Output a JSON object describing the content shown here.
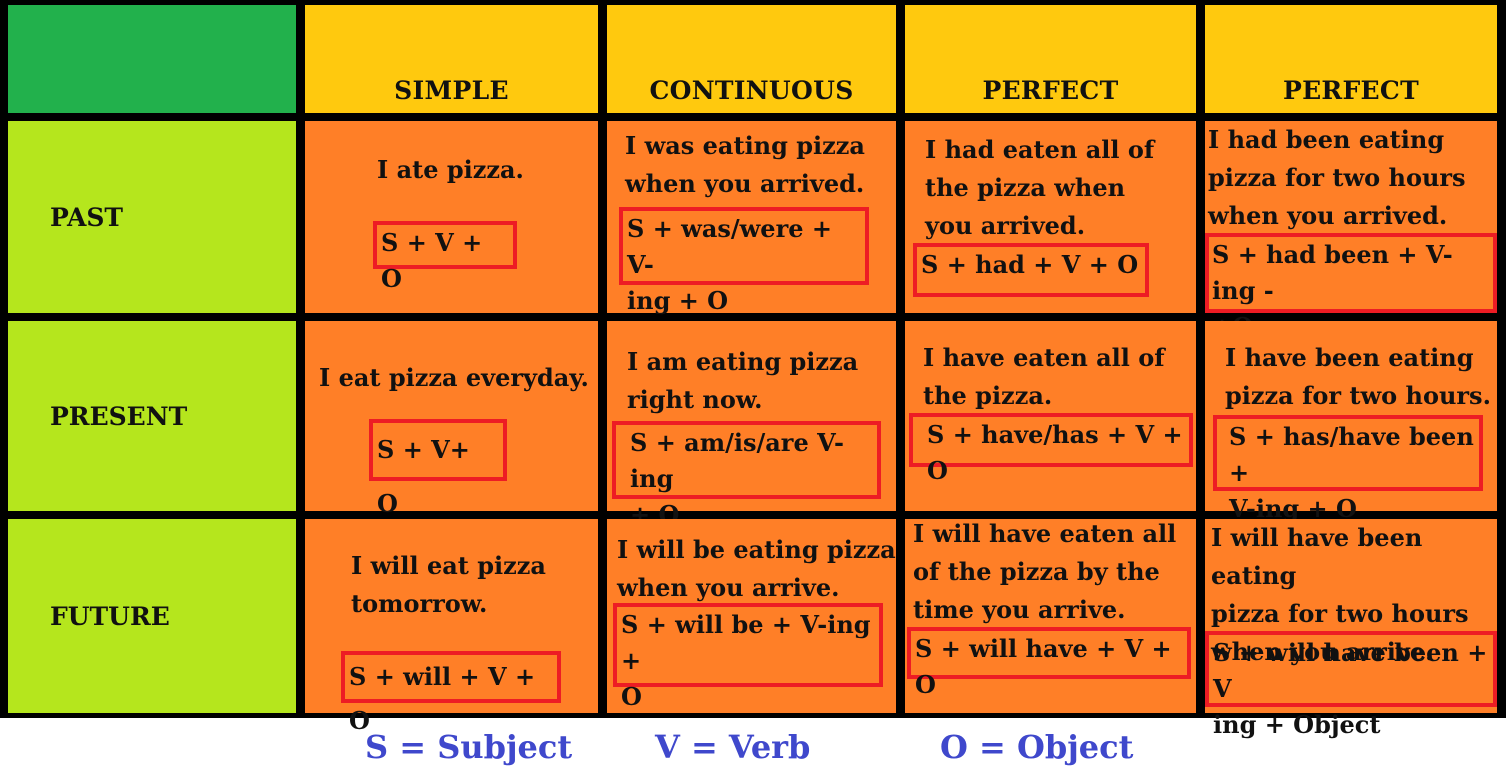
{
  "table": {
    "columns": [
      "SIMPLE",
      "CONTINUOUS",
      "PERFECT",
      "PERFECT"
    ],
    "rows": [
      {
        "label": "PAST",
        "cells": [
          {
            "example": "I ate pizza.",
            "formula": "S + V + O"
          },
          {
            "example": "I was eating pizza\nwhen you arrived.",
            "formula": "S + was/were + V-\ning + O"
          },
          {
            "example": "I had eaten all of\nthe pizza when\nyou arrived.",
            "formula": "S + had + V + O"
          },
          {
            "example": "I had been eating\npizza for two hours\nwhen you arrived.",
            "formula": "S + had been + V-ing -\n+O"
          }
        ]
      },
      {
        "label": "PRESENT",
        "cells": [
          {
            "example": "I eat pizza everyday.",
            "formula": "S + V+ O"
          },
          {
            "example": "I am eating pizza\nright now.",
            "formula": "S + am/is/are V-ing\n+ O"
          },
          {
            "example": "I have eaten all of\nthe pizza.",
            "formula": "S + have/has + V + O"
          },
          {
            "example": "I have been eating\npizza for two hours.",
            "formula": "S + has/have been +\nV-ing + O"
          }
        ]
      },
      {
        "label": "FUTURE",
        "cells": [
          {
            "example": "I will eat pizza\ntomorrow.",
            "formula": "S + will + V + O"
          },
          {
            "example": "I will be eating pizza\nwhen you arrive.",
            "formula": "S + will be + V-ing +\nO"
          },
          {
            "example": "I will have eaten all\nof the pizza by the\ntime you arrive.",
            "formula": "S + will have + V + O"
          },
          {
            "example": "I will have been eating\npizza for two hours\nwhen you arrive.",
            "formula": "S + will have been + V\ning + Object"
          }
        ]
      }
    ]
  },
  "legend": [
    "S = Subject",
    "V = Verb",
    "O = Object"
  ],
  "colors": {
    "corner": "#22b14c",
    "header": "#ffc90e",
    "row_header": "#b5e61d",
    "body": "#ff7f27",
    "formula_border": "#ed1c24",
    "legend_text": "#3f48cc"
  }
}
